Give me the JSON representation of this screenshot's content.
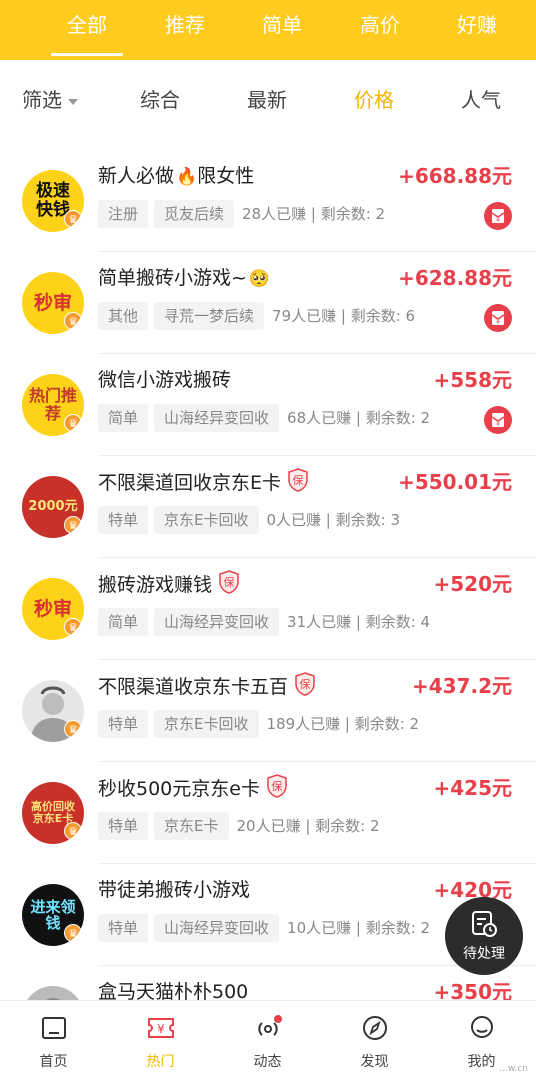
{
  "top_tabs": [
    {
      "label": "全部",
      "active": true
    },
    {
      "label": "推荐",
      "active": false
    },
    {
      "label": "简单",
      "active": false
    },
    {
      "label": "高价",
      "active": false
    },
    {
      "label": "好赚",
      "active": false
    }
  ],
  "filters": {
    "filter_label": "筛选",
    "sorts": [
      {
        "label": "综合",
        "active": false
      },
      {
        "label": "最新",
        "active": false
      },
      {
        "label": "价格",
        "active": true
      },
      {
        "label": "人气",
        "active": false
      }
    ]
  },
  "tasks": [
    {
      "avatar_text": "极速快钱",
      "title": "新人必做",
      "emoji": "🔥",
      "title_suffix": "限女性",
      "guarantee": false,
      "price": "+668.88元",
      "tag1": "注册",
      "tag2": "觅友后续",
      "stats": "28人已赚 | 剩余数: 2",
      "red_icon": true
    },
    {
      "avatar_text": "秒审",
      "title": "简单搬砖小游戏~",
      "emoji": "🥺",
      "title_suffix": "",
      "guarantee": false,
      "price": "+628.88元",
      "tag1": "其他",
      "tag2": "寻荒一梦后续",
      "stats": "79人已赚 | 剩余数: 6",
      "red_icon": true
    },
    {
      "avatar_text": "热门推荐",
      "title": "微信小游戏搬砖",
      "emoji": "",
      "title_suffix": "",
      "guarantee": false,
      "price": "+558元",
      "tag1": "简单",
      "tag2": "山海经异变回收",
      "stats": "68人已赚 | 剩余数: 2",
      "red_icon": true
    },
    {
      "avatar_text": "2000元",
      "title": "不限渠道回收京东E卡",
      "emoji": "",
      "title_suffix": "",
      "guarantee": true,
      "price": "+550.01元",
      "tag1": "特单",
      "tag2": "京东E卡回收",
      "stats": "0人已赚 | 剩余数: 3",
      "red_icon": false
    },
    {
      "avatar_text": "秒审",
      "title": "搬砖游戏赚钱",
      "emoji": "",
      "title_suffix": "",
      "guarantee": true,
      "price": "+520元",
      "tag1": "简单",
      "tag2": "山海经异变回收",
      "stats": "31人已赚 | 剩余数: 4",
      "red_icon": false
    },
    {
      "avatar_text": "",
      "title": "不限渠道收京东卡五百",
      "emoji": "",
      "title_suffix": "",
      "guarantee": true,
      "price": "+437.2元",
      "tag1": "特单",
      "tag2": "京东E卡回收",
      "stats": "189人已赚 | 剩余数: 2",
      "red_icon": false
    },
    {
      "avatar_text": "高价回收京东E卡",
      "title": "秒收500元京东e卡",
      "emoji": "",
      "title_suffix": "",
      "guarantee": true,
      "price": "+425元",
      "tag1": "特单",
      "tag2": "京东E卡",
      "stats": "20人已赚 | 剩余数: 2",
      "red_icon": false
    },
    {
      "avatar_text": "进来领钱",
      "title": "带徒弟搬砖小游戏",
      "emoji": "",
      "title_suffix": "",
      "guarantee": false,
      "price": "+420元",
      "tag1": "特单",
      "tag2": "山海经异变回收",
      "stats": "10人已赚 | 剩余数: 2",
      "red_icon": false
    },
    {
      "avatar_text": "",
      "title": "盒马天猫朴朴500",
      "emoji": "",
      "title_suffix": "",
      "guarantee": false,
      "price": "+350元",
      "tag1": "",
      "tag2": "",
      "stats": "",
      "red_icon": false
    }
  ],
  "fab": {
    "label": "待处理"
  },
  "bottom_nav": [
    {
      "label": "首页",
      "icon": "home-icon",
      "active": false
    },
    {
      "label": "热门",
      "icon": "ticket-yen-icon",
      "active": true
    },
    {
      "label": "动态",
      "icon": "broadcast-icon",
      "active": false
    },
    {
      "label": "发现",
      "icon": "compass-icon",
      "active": false
    },
    {
      "label": "我的",
      "icon": "user-icon",
      "active": false
    }
  ],
  "watermark": "...w.cn",
  "colors": {
    "brand_yellow": "#FFCB1F",
    "price_red": "#E8404A",
    "active_sort": "#F4B400"
  }
}
